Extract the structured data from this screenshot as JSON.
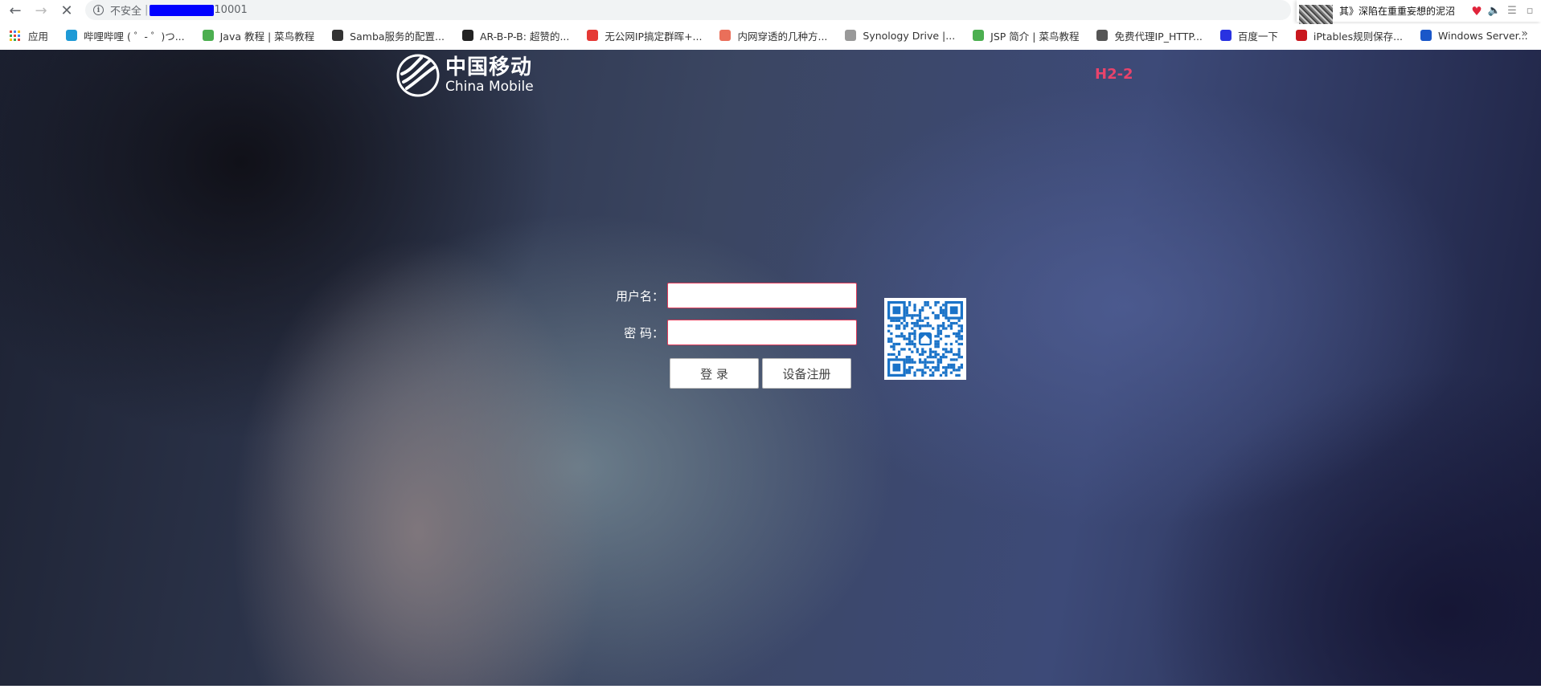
{
  "browser": {
    "nav": {
      "back_icon": "←",
      "forward_icon": "→",
      "stop_icon": "✕"
    },
    "security_label": "不安全",
    "url_separator": "|",
    "url_visible": "10001"
  },
  "media_widget": {
    "title": "其》深陷在重重妄想的泥沼",
    "icons": [
      "heart-icon",
      "volume-icon",
      "playlist-icon",
      "window-icon"
    ]
  },
  "bookmarks": {
    "apps_label": "应用",
    "items": [
      {
        "label": "哔哩哔哩 ( ゜- ゜)つ...",
        "icon": "bilibili-icon",
        "color": "#1e9ad6"
      },
      {
        "label": "Java 教程 | 菜鸟教程",
        "icon": "runoob-icon",
        "color": "#4caf50"
      },
      {
        "label": "Samba服务的配置...",
        "icon": "samba-icon",
        "color": "#333333"
      },
      {
        "label": "AR-B-P-B: 超赞的...",
        "icon": "ar-icon",
        "color": "#222222"
      },
      {
        "label": "无公网IP搞定群晖+...",
        "icon": "zhihu-red-icon",
        "color": "#e53935"
      },
      {
        "label": "内网穿透的几种方...",
        "icon": "jianshu-icon",
        "color": "#ea6f5a"
      },
      {
        "label": "Synology Drive |...",
        "icon": "synology-icon",
        "color": "#999999"
      },
      {
        "label": "JSP 简介 | 菜鸟教程",
        "icon": "runoob-icon",
        "color": "#4caf50"
      },
      {
        "label": "免费代理IP_HTTP...",
        "icon": "globe-icon",
        "color": "#555555"
      },
      {
        "label": "百度一下",
        "icon": "baidu-icon",
        "color": "#2932e1"
      },
      {
        "label": "iPtables规则保存...",
        "icon": "csdn-icon",
        "color": "#c9171e"
      },
      {
        "label": "Windows Server...",
        "icon": "windows-icon",
        "color": "#1a57c9"
      }
    ],
    "overflow": "»"
  },
  "page": {
    "logo": {
      "cn": "中国移动",
      "en": "China Mobile"
    },
    "device_code": "H2-2",
    "form": {
      "username_label": "用户名：",
      "password_label": "密  码：",
      "username_value": "",
      "password_value": "",
      "login_button": "登  录",
      "register_button": "设备注册"
    },
    "colors": {
      "accent_red": "#e03c5a",
      "device_code": "#e8436b",
      "qr_blue": "#1a73c8"
    }
  }
}
